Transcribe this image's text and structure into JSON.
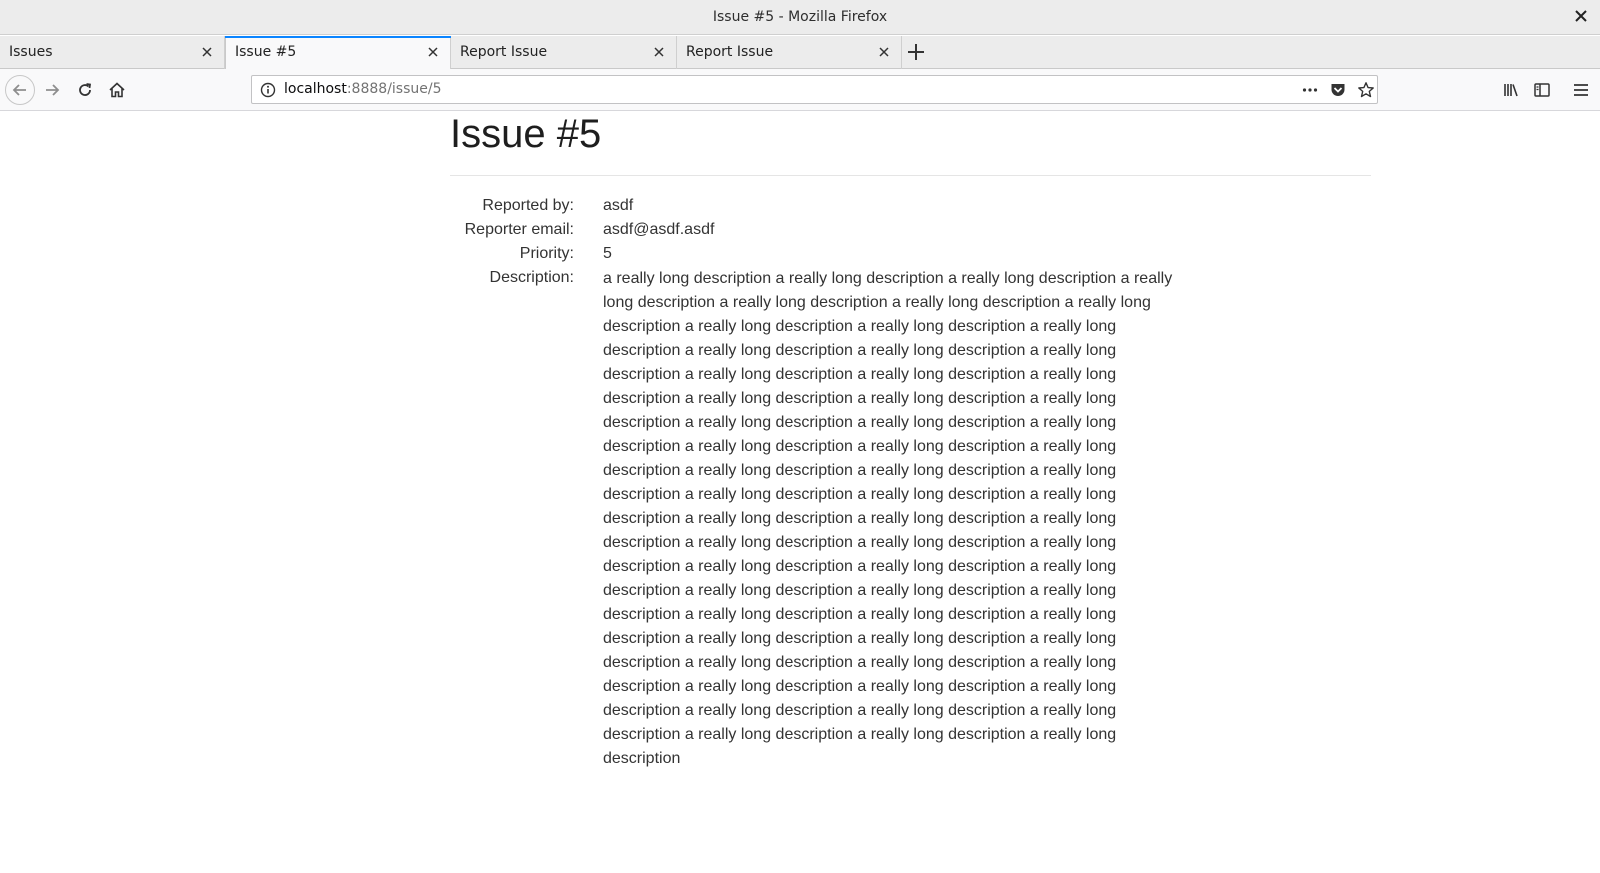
{
  "window": {
    "title": "Issue #5 - Mozilla Firefox"
  },
  "tabs": [
    {
      "label": "Issues",
      "active": false
    },
    {
      "label": "Issue #5",
      "active": true
    },
    {
      "label": "Report Issue",
      "active": false
    },
    {
      "label": "Report Issue",
      "active": false
    }
  ],
  "urlbar": {
    "host": "localhost",
    "path": ":8888/issue/5"
  },
  "issue": {
    "title": "Issue #5",
    "reported_by_label": "Reported by:",
    "reported_by": "asdf",
    "email_label": "Reporter email:",
    "email": "asdf@asdf.asdf",
    "priority_label": "Priority:",
    "priority": "5",
    "description_label": "Description:",
    "description": "a really long description a really long description a really long description a really long description a really long description a really long description a really long description a really long description a really long description a really long description a really long description a really long description a really long description a really long description a really long description a really long description a really long description a really long description a really long description a really long description a really long description a really long description a really long description a really long description a really long description a really long description a really long description a really long description a really long description a really long description a really long description a really long description a really long description a really long description a really long description a really long description a really long description a really long description a really long description a really long description a really long description a really long description a really long description a really long description a really long description a really long description a really long description a really long description a really long description a really long description a really long description a really long description a really long description a really long description a really long description a really long description a really long description a really long description a really long description a really long description a really long description"
  },
  "icons": {
    "back": "back-arrow-icon",
    "forward": "forward-arrow-icon",
    "reload": "reload-icon",
    "home": "home-icon",
    "info": "info-icon",
    "page_actions": "ellipsis-icon",
    "pocket": "pocket-icon",
    "bookmark": "star-icon",
    "library": "library-icon",
    "sidebar": "sidebar-icon",
    "menu": "hamburger-menu-icon"
  },
  "colors": {
    "active_tab_accent": "#0a84ff"
  }
}
